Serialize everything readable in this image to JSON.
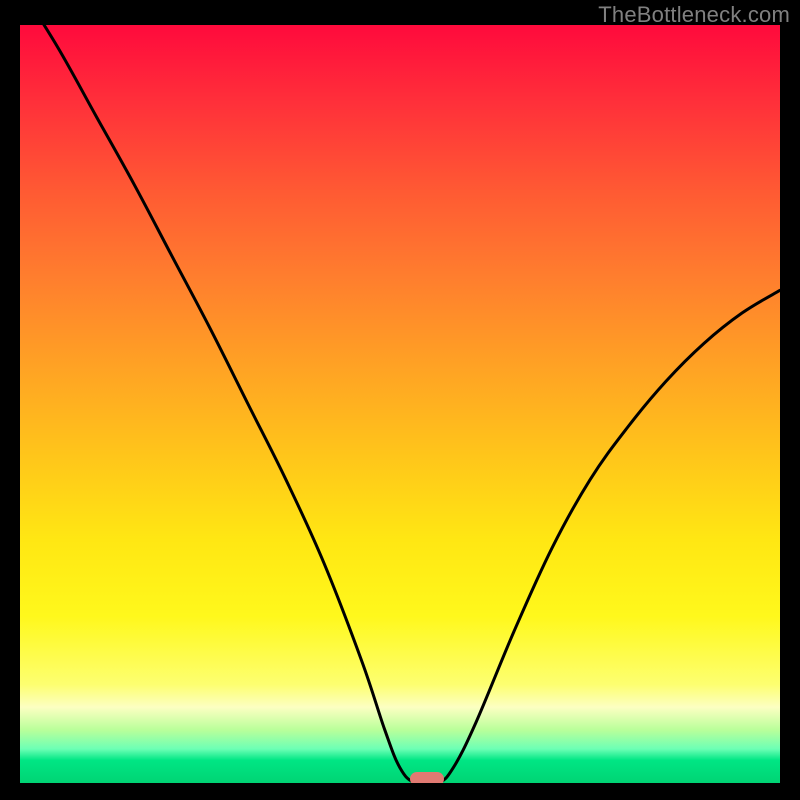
{
  "watermark": "TheBottleneck.com",
  "chart_data": {
    "type": "line",
    "title": "",
    "xlabel": "",
    "ylabel": "",
    "xlim": [
      0,
      100
    ],
    "ylim": [
      0,
      100
    ],
    "grid": false,
    "series": [
      {
        "name": "bottleneck-curve",
        "x": [
          0,
          5,
          10,
          15,
          20,
          25,
          30,
          35,
          40,
          45,
          48,
          50,
          52,
          55,
          57,
          60,
          65,
          70,
          75,
          80,
          85,
          90,
          95,
          100
        ],
        "y": [
          105,
          97,
          88,
          79,
          69.5,
          60,
          50,
          40,
          29,
          16,
          7,
          2,
          0,
          0,
          2,
          8,
          20,
          31,
          40,
          47,
          53,
          58,
          62,
          65
        ]
      }
    ],
    "marker": {
      "x": 53.5,
      "y": 0
    },
    "background_gradient": {
      "stops": [
        {
          "pct": 0,
          "color": "#ff0a3c"
        },
        {
          "pct": 50,
          "color": "#ffd21a"
        },
        {
          "pct": 90,
          "color": "#fdffa0"
        },
        {
          "pct": 100,
          "color": "#00d474"
        }
      ]
    }
  }
}
